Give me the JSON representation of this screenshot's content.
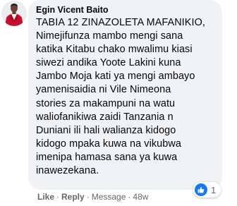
{
  "comment": {
    "author": "Egin Vicent Baito",
    "lines": [
      "TABIA 12 ZINAZOLETA MAFANIKIO,",
      "Nimejifunza mambo mengi sana",
      "katika Kitabu chako mwalimu kiasi",
      "siwezi andika Yoote Lakini kuna",
      "Jambo Moja kati ya mengi ambayo",
      "yamenisaidia ni Vile Nimeona",
      "stories za makampuni na watu",
      "waliofanikiwa zaidi Tanzania n",
      "Duniani ili hali walianza kidogo",
      "kidogo mpaka kuwa na vikubwa",
      "imenipa hamasa sana ya kuwa",
      "inawezekana."
    ],
    "reactions": {
      "icon": "like-thumb-icon",
      "count": "1",
      "color": "#1877f2"
    }
  },
  "actions": {
    "like": "Like",
    "reply": "Reply",
    "message": "Message",
    "time": "48w",
    "separator": "·"
  },
  "colors": {
    "bubble": "#f0f2f5",
    "text": "#050505",
    "meta": "#65676b",
    "avatar_jacket": "#c8102e"
  }
}
